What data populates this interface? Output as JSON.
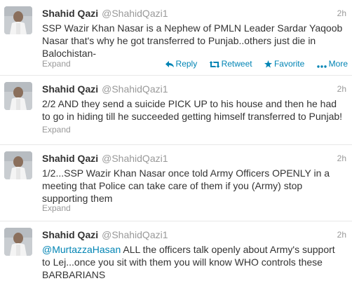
{
  "colors": {
    "link": "#0084b4",
    "muted": "#999999",
    "text": "#333333",
    "divider": "#e8e8e8"
  },
  "tweets": [
    {
      "name": "Shahid Qazi",
      "handle": "@ShahidQazi1",
      "time": "2h",
      "text": "SSP Wazir Khan Nasar is a Nephew of PMLN Leader Sardar Yaqoob Nasar that's why he got transferred to Punjab..others just die in Balochistan-",
      "expand": "Expand",
      "actions": {
        "reply": "Reply",
        "retweet": "Retweet",
        "favorite": "Favorite",
        "more": "More"
      }
    },
    {
      "name": "Shahid Qazi",
      "handle": "@ShahidQazi1",
      "time": "2h",
      "text": "2/2 AND they send a suicide PICK UP to his house and then he had to go in hiding till he succeeded getting himself transferred to Punjab!",
      "expand": "Expand"
    },
    {
      "name": "Shahid Qazi",
      "handle": "@ShahidQazi1",
      "time": "2h",
      "text": "1/2...SSP Wazir Khan Nasar once told Army Officers OPENLY in a meeting that Police can take care of them if you (Army) stop supporting them",
      "expand": "Expand"
    },
    {
      "name": "Shahid Qazi",
      "handle": "@ShahidQazi1",
      "time": "2h",
      "mention": "@MurtazzaHasan",
      "text": " ALL the officers talk openly about Army's support to Lej...once you sit with them you will know WHO controls these BARBARIANS"
    }
  ]
}
